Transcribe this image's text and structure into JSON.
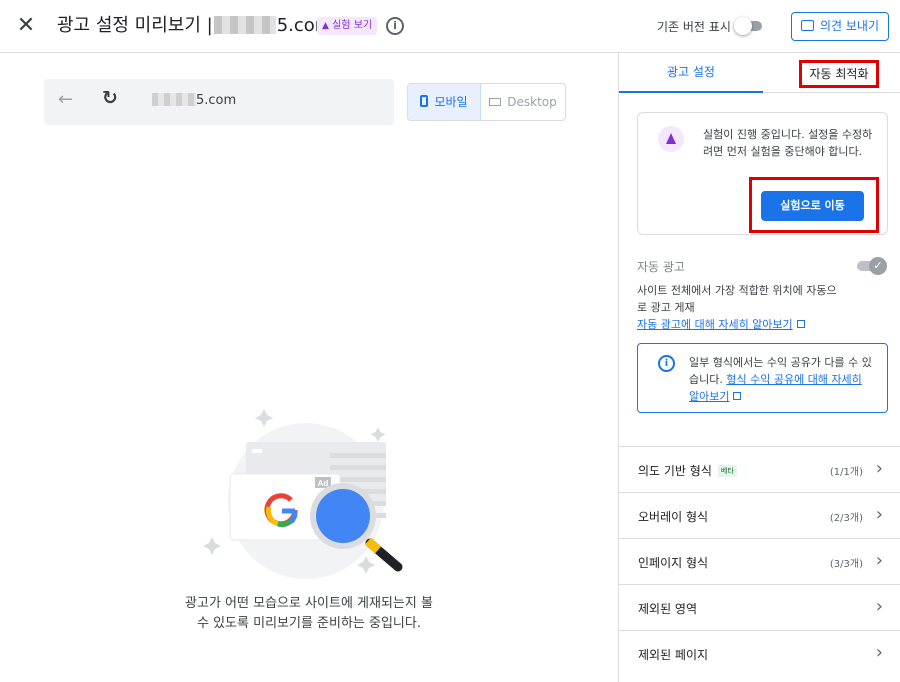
{
  "header": {
    "close_label": "✕",
    "title_prefix": "광고 설정 미리보기 |",
    "title_suffix": "5.com",
    "badge": "실험 보기",
    "info_label": "i",
    "legacy_label": "기존 버전 표시",
    "feedback_label": "의견 보내기"
  },
  "preview": {
    "url_suffix": "5.com",
    "mobile_label": "모바일",
    "desktop_label": "Desktop",
    "ad_label": "Ad",
    "loading_line1": "광고가 어떤 모습으로 사이트에 게재되는지 볼",
    "loading_line2": "수 있도록 미리보기를 준비하는 중입니다."
  },
  "sidebar": {
    "tabs": [
      {
        "label": "광고 설정",
        "active": true
      },
      {
        "label": "자동 최적화",
        "active": false
      }
    ],
    "experiment": {
      "message": "실험이 진행 중입니다. 설정을 수정하려면 먼저 실험을 중단해야 합니다.",
      "button": "실험으로 이동"
    },
    "auto_ads": {
      "title": "자동 광고",
      "description": "사이트 전체에서 가장 적합한 위치에 자동으로 광고 게재",
      "link": "자동 광고에 대해 자세히 알아보기"
    },
    "revenue_info": {
      "text": "일부 형식에서는 수익 공유가 다를 수 있습니다.",
      "link": "형식 수익 공유에 대해 자세히 알아보기"
    },
    "rows": [
      {
        "label": "의도 기반 형식",
        "beta": "베타",
        "count": "(1/1개)"
      },
      {
        "label": "오버레이 형식",
        "count": "(2/3개)"
      },
      {
        "label": "인페이지 형식",
        "count": "(3/3개)"
      },
      {
        "label": "제외된 영역",
        "count": ""
      },
      {
        "label": "제외된 페이지",
        "count": ""
      }
    ]
  },
  "colors": {
    "accent": "#1a73e8",
    "highlight": "#e00000",
    "experiment": "#8430ce"
  }
}
